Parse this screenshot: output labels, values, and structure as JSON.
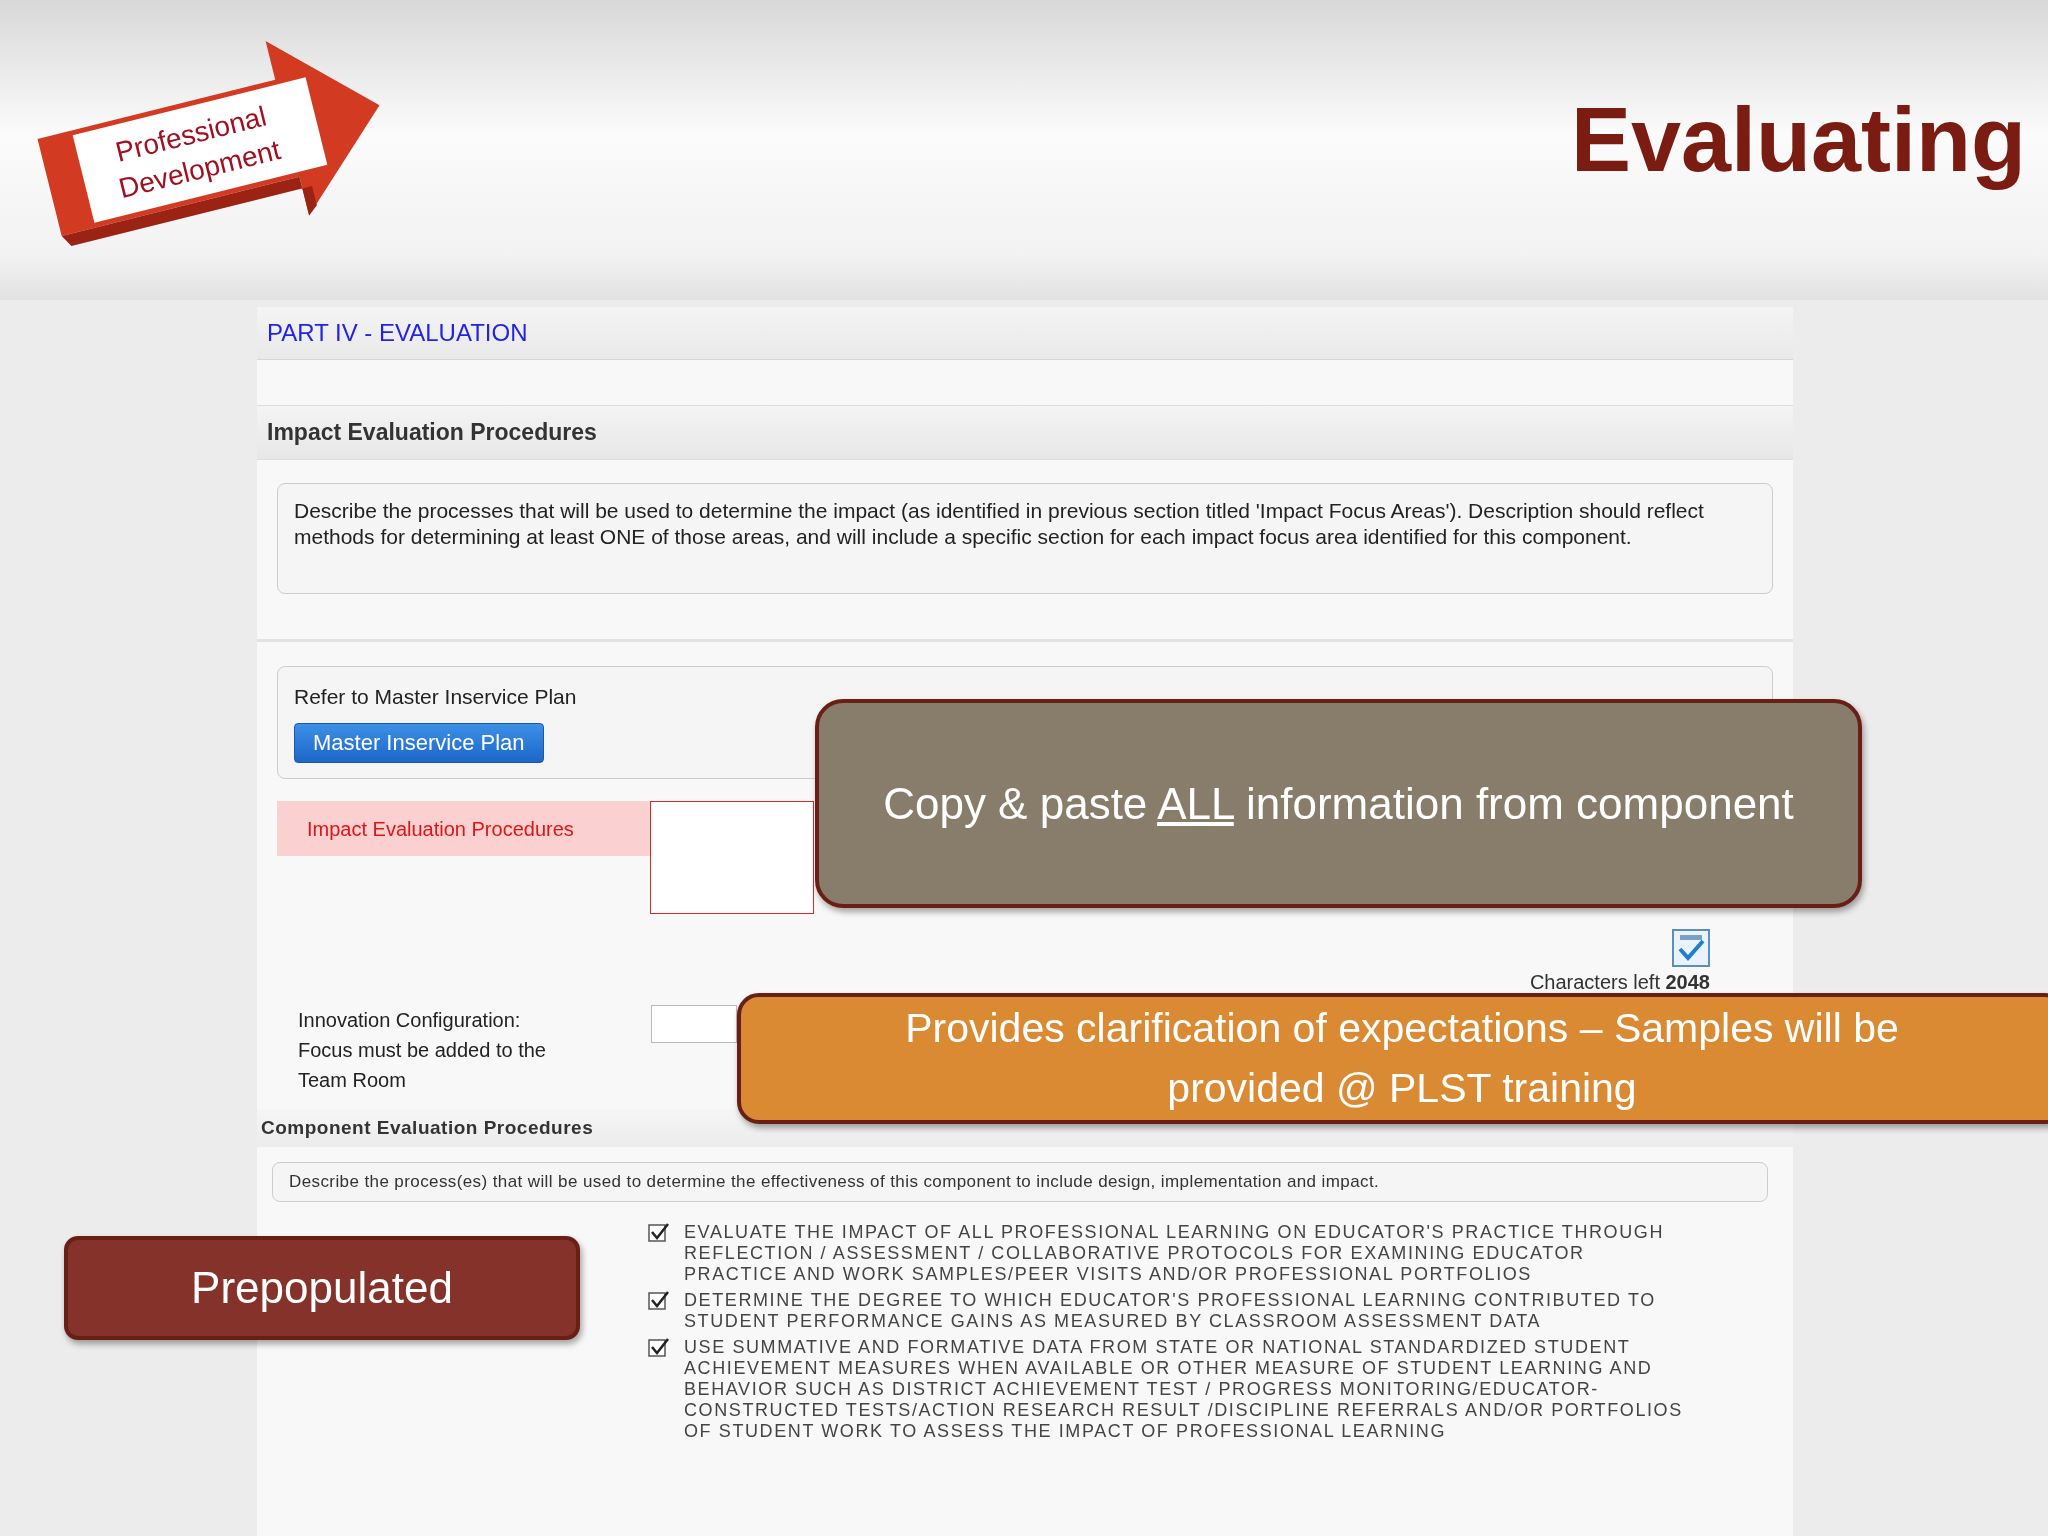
{
  "header": {
    "logo": {
      "line1": "Professional",
      "line2": "Development"
    },
    "title": "Evaluating"
  },
  "form": {
    "part_title": "PART IV - EVALUATION",
    "impact_section": {
      "heading": "Impact Evaluation Procedures",
      "description": "Describe the processes that will be used to determine the impact (as identified in previous section titled 'Impact Focus Areas'). Description should reflect methods for determining at least ONE of those areas, and will include a specific section for each impact focus area identified for this component."
    },
    "refer": {
      "label": "Refer to Master Inservice Plan",
      "button": "Master Inservice Plan"
    },
    "impact_field": {
      "label": "Impact Evaluation Procedures"
    },
    "characters_left": "Characters left **2048**",
    "innovation": {
      "label": "Innovation Configuration: Focus must be added to the Team Room"
    },
    "component_section": {
      "heading": "Component Evaluation Procedures",
      "description": "Describe the process(es) that will be used to determine the effectiveness of this component to include design, implementation and impact."
    },
    "options": [
      {
        "text": "EVALUATE THE IMPACT OF ALL PROFESSIONAL LEARNING ON EDUCATOR'S PRACTICE THROUGH REFLECTION / ASSESSMENT / COLLABORATIVE PROTOCOLS FOR EXAMINING EDUCATOR PRACTICE AND WORK SAMPLES/PEER VISITS AND/OR PROFESSIONAL PORTFOLIOS",
        "checked": true
      },
      {
        "text": "DETERMINE THE DEGREE TO WHICH EDUCATOR'S PROFESSIONAL LEARNING CONTRIBUTED TO STUDENT PERFORMANCE GAINS AS MEASURED BY CLASSROOM ASSESSMENT DATA",
        "checked": true
      },
      {
        "text": "USE SUMMATIVE AND FORMATIVE DATA FROM STATE OR NATIONAL STANDARDIZED STUDENT ACHIEVEMENT MEASURES WHEN AVAILABLE OR OTHER MEASURE OF STUDENT LEARNING AND BEHAVIOR SUCH AS DISTRICT ACHIEVEMENT TEST / PROGRESS MONITORING/EDUCATOR-CONSTRUCTED TESTS/ACTION RESEARCH RESULT /DISCIPLINE REFERRALS AND/OR PORTFOLIOS OF STUDENT WORK TO ASSESS THE IMPACT OF PROFESSIONAL LEARNING",
        "checked": true
      }
    ]
  },
  "callouts": [
    {
      "color": "#877d6a",
      "parts": [
        {
          "text": "Copy & paste ",
          "underlined": false
        },
        {
          "text": "ALL",
          "underlined": true
        },
        {
          "text": " information from component",
          "underlined": false
        }
      ]
    },
    {
      "color": "#d98a32",
      "parts": [
        {
          "text": "Provides clarification of expectations – Samples will be provided @ PLST training",
          "underlined": false
        }
      ]
    },
    {
      "color": "#84322a",
      "parts": [
        {
          "text": "Prepopulated",
          "underlined": false
        }
      ]
    }
  ]
}
